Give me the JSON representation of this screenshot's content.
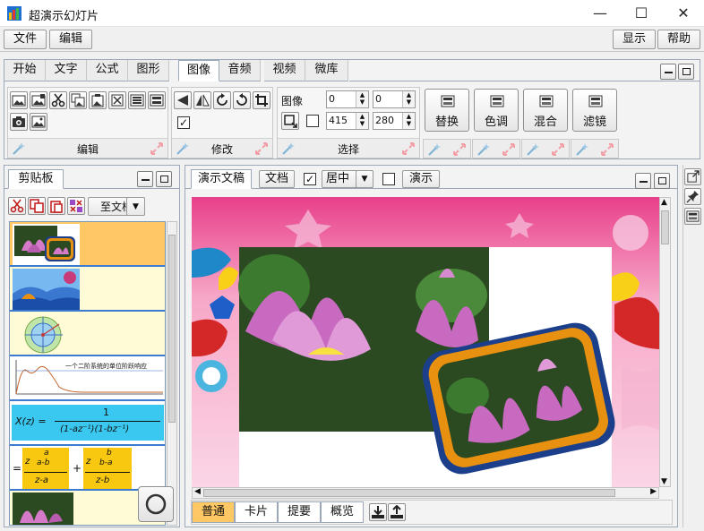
{
  "window": {
    "title": "超演示幻灯片",
    "controls": {
      "minimize": "—",
      "maximize": "☐",
      "close": "✕"
    }
  },
  "menubar": {
    "left": [
      "文件",
      "编辑"
    ],
    "right": [
      "显示",
      "帮助"
    ]
  },
  "ribbon": {
    "tabs": [
      "开始",
      "文字",
      "公式",
      "图形",
      "图像",
      "音频",
      "视频",
      "微库"
    ],
    "active_tab": "图像",
    "groups": {
      "edit": "编辑",
      "modify": "修改",
      "select": "选择"
    },
    "select": {
      "image_label": "图像",
      "x": "0",
      "y": "0",
      "width": "415",
      "height": "280"
    },
    "big_buttons": [
      "替换",
      "色调",
      "混合",
      "滤镜"
    ]
  },
  "clipboard": {
    "tab": "剪贴板",
    "to_doc": "至文档",
    "formula1_lhs": "X(z) =",
    "formula1_num": "1",
    "formula1_den": "(1-az⁻¹)(1-bz⁻¹)",
    "formula2_lead": "=",
    "formula2_frac1_num": "a",
    "formula2_frac1_den": "a-b",
    "formula2_frac1_lead": "z",
    "formula2_frac1_bottom": "z-a",
    "formula2_frac2_num": "b",
    "formula2_frac2_den": "b-a",
    "formula2_frac2_lead": "z",
    "formula2_frac2_bottom": "z-b",
    "plot_caption": "一个二阶系统的单位阶跃响应"
  },
  "document": {
    "tab": "演示文稿",
    "doc_button": "文档",
    "align": "居中",
    "present_button": "演示",
    "views": [
      "普通",
      "卡片",
      "提要",
      "概览"
    ],
    "active_view": "普通"
  },
  "colors": {
    "accent_orange": "#ffc864",
    "clip_bg": "#fffbd6",
    "select_border": "#3c7bd0",
    "canvas_pink": "#f2b8d0"
  }
}
